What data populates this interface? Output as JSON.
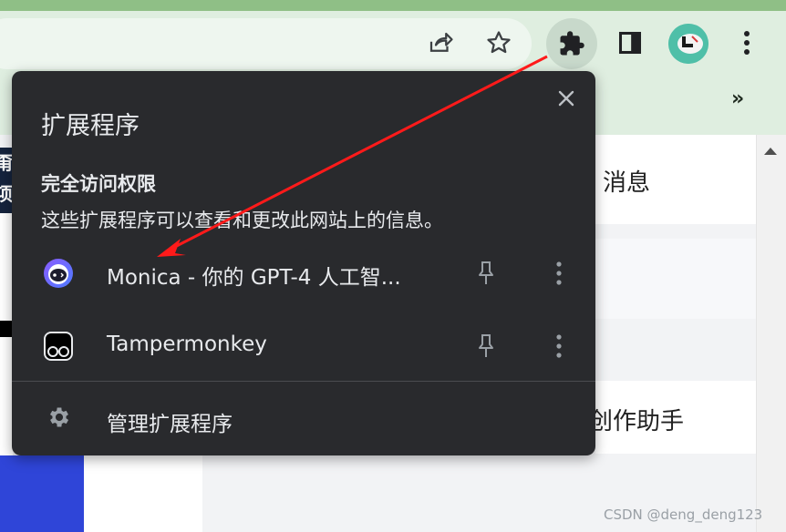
{
  "toolbar": {
    "share_icon": "share-icon",
    "bookmark_icon": "star-icon",
    "extensions_icon": "puzzle-icon",
    "side_panel_icon": "side-panel-icon",
    "profile_icon": "avatar",
    "menu_icon": "kebab-menu-icon"
  },
  "bookmarks_bar": {
    "more_label": "»"
  },
  "page": {
    "left_partial_text": [
      "甭",
      "项"
    ],
    "messages_label": "消息",
    "create_assistant_label": "创作助手",
    "watermark": "CSDN @deng_deng123"
  },
  "extensions_popup": {
    "title": "扩展程序",
    "close_icon": "close-icon",
    "section_heading": "完全访问权限",
    "section_description": "这些扩展程序可以查看和更改此网站上的信息。",
    "extensions": [
      {
        "name": "Monica - 你的 GPT-4 人工智...",
        "icon": "monica-logo-icon",
        "pinned": false
      },
      {
        "name": "Tampermonkey",
        "icon": "tampermonkey-logo-icon",
        "pinned": false
      }
    ],
    "manage_label": "管理扩展程序",
    "manage_icon": "gear-icon"
  },
  "colors": {
    "popup_bg": "#292a2d",
    "popup_text": "#e8eaed",
    "toolbar_bg": "#dfeee0",
    "annotation_arrow": "#ff1a1a"
  }
}
